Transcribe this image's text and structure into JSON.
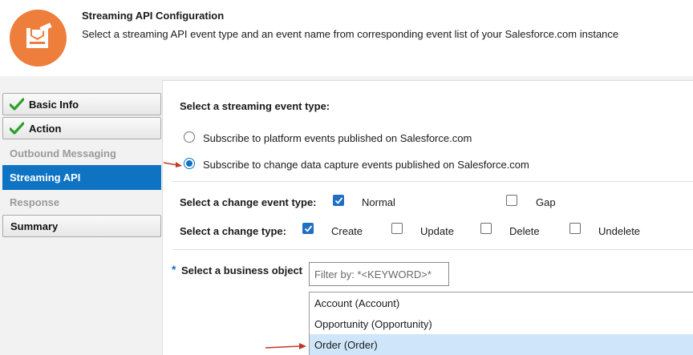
{
  "header": {
    "title": "Streaming API Configuration",
    "description": "Select a streaming API event type and an event name from corresponding event list of your Salesforce.com instance",
    "logo_color": "#ee7e3b"
  },
  "sidebar": {
    "steps": [
      {
        "label": "Basic Info",
        "state": "done"
      },
      {
        "label": "Action",
        "state": "done"
      },
      {
        "label": "Outbound Messaging",
        "state": "disabled"
      },
      {
        "label": "Streaming API",
        "state": "active"
      },
      {
        "label": "Response",
        "state": "disabled"
      },
      {
        "label": "Summary",
        "state": "boxed"
      }
    ],
    "active_color": "#0f73c3"
  },
  "main": {
    "event_type_label": "Select a streaming event type:",
    "event_options": [
      {
        "label": "Subscribe to platform events published on Salesforce.com",
        "selected": false
      },
      {
        "label": "Subscribe to change data capture events published on Salesforce.com",
        "selected": true
      }
    ],
    "change_event_type": {
      "label": "Select a change event type:",
      "options": [
        {
          "label": "Normal",
          "checked": true
        },
        {
          "label": "Gap",
          "checked": false
        }
      ]
    },
    "change_type": {
      "label": "Select a change type:",
      "options": [
        {
          "label": "Create",
          "checked": true
        },
        {
          "label": "Update",
          "checked": false
        },
        {
          "label": "Delete",
          "checked": false
        },
        {
          "label": "Undelete",
          "checked": false
        }
      ]
    },
    "business_object": {
      "required_mark": "*",
      "label": "Select a business object",
      "filter_placeholder": "Filter by: *<KEYWORD>*",
      "items": [
        {
          "label": "Account (Account)",
          "selected": false
        },
        {
          "label": "Opportunity (Opportunity)",
          "selected": false
        },
        {
          "label": "Order (Order)",
          "selected": true
        }
      ]
    }
  }
}
